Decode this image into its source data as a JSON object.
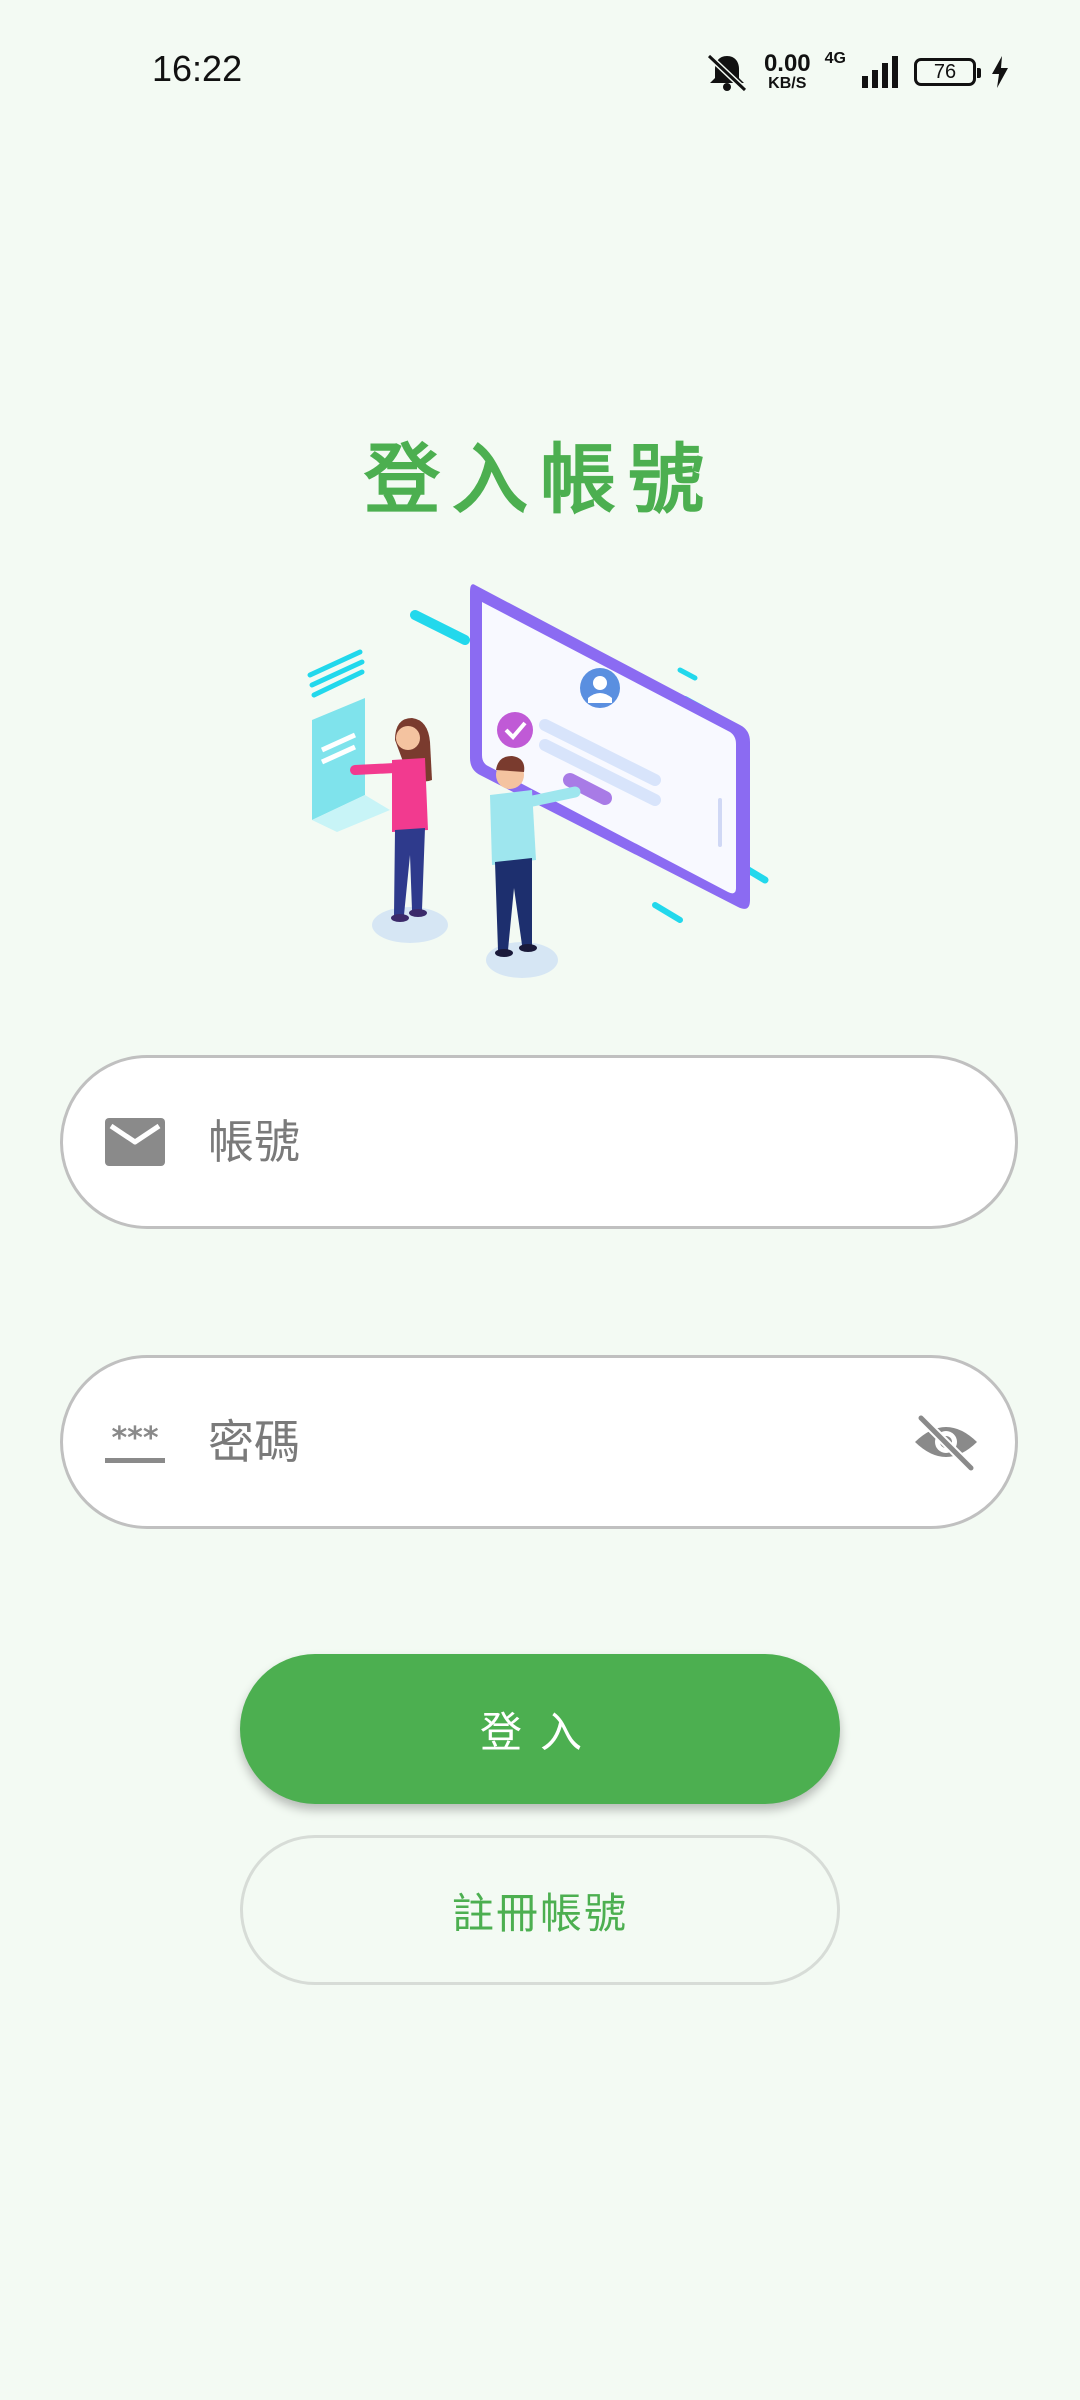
{
  "status_bar": {
    "time": "16:22",
    "net_speed": "0.00",
    "net_speed_unit": "KB/S",
    "network_type": "4G",
    "battery_level": "76",
    "icons": [
      "mute-bell-icon",
      "signal-icon",
      "battery-icon",
      "charging-bolt-icon"
    ]
  },
  "login": {
    "title": "登入帳號",
    "account_placeholder": "帳號",
    "account_value": "",
    "password_placeholder": "密碼",
    "password_value": "",
    "account_icon": "mail-icon",
    "password_icon": "password-stars-icon",
    "visibility_icon": "eye-off-icon",
    "login_button": "登入",
    "register_button": "註冊帳號"
  },
  "colors": {
    "accent": "#4caf50",
    "background": "#f3faf3",
    "field_border": "#c0c0c0",
    "icon_gray": "#8a8a8a"
  }
}
